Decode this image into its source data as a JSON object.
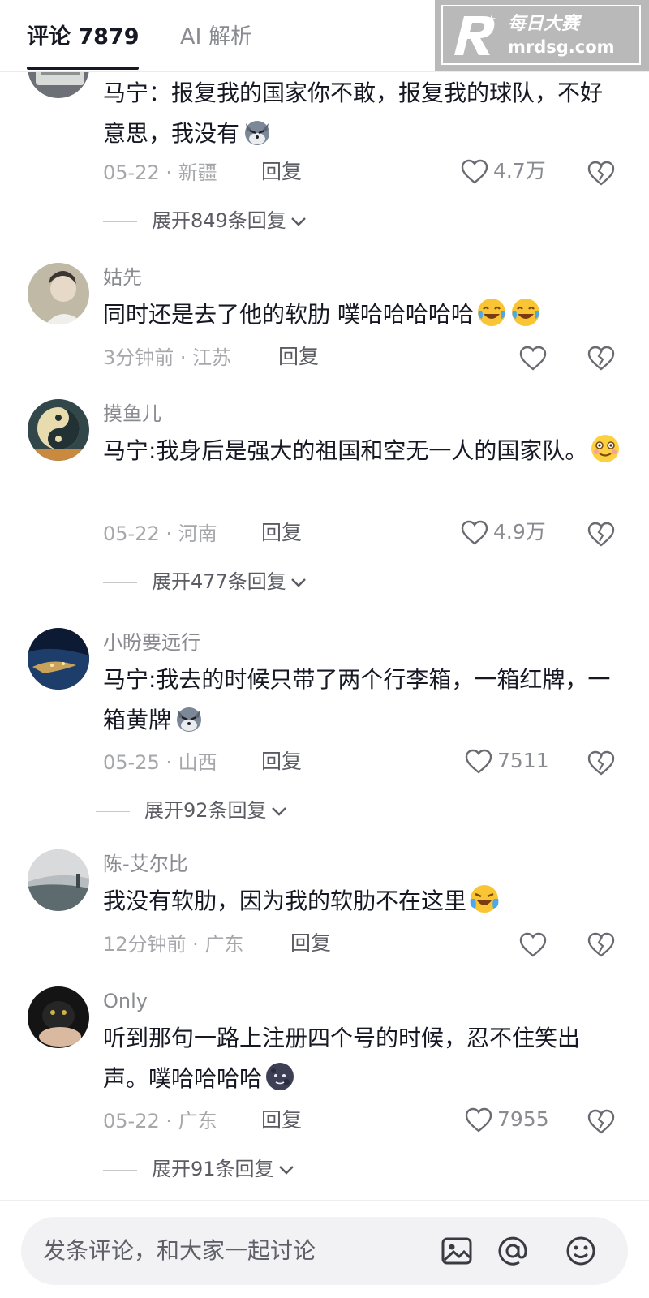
{
  "header": {
    "tab_comments": "评论 7879",
    "tab_ai": "AI 解析"
  },
  "watermark": {
    "cn": "每日大赛",
    "url": "mrdsg.com"
  },
  "comments": [
    {
      "username": "",
      "text": "马宁：报复我的国家你不敢，报复我的球队，不好意思，我没有",
      "emoji": "wolf-emoji",
      "date": "05-22",
      "location": "新疆",
      "reply_label": "回复",
      "likes": "4.7万",
      "expand": "展开849条回复"
    },
    {
      "username": "姑先",
      "text": "同时还是去了他的软肋 噗哈哈哈哈哈",
      "emoji": "laugh-cry-emoji",
      "date": "3分钟前",
      "location": "江苏",
      "reply_label": "回复",
      "likes": ""
    },
    {
      "username": "摸鱼儿",
      "text": "马宁:我身后是强大的祖国和空无一人的国家队。",
      "emoji": "smile-emoji",
      "date": "05-22",
      "location": "河南",
      "reply_label": "回复",
      "likes": "4.9万",
      "expand": "展开477条回复"
    },
    {
      "username": "小盼要远行",
      "text": "马宁:我去的时候只带了两个行李箱，一箱红牌，一箱黄牌",
      "emoji": "wolf-emoji",
      "date": "05-25",
      "location": "山西",
      "reply_label": "回复",
      "likes": "7511",
      "expand": "展开92条回复"
    },
    {
      "username": "陈-艾尔比",
      "text": "我没有软肋，因为我的软肋不在这里",
      "emoji": "cry-laugh-emoji",
      "date": "12分钟前",
      "location": "广东",
      "reply_label": "回复",
      "likes": ""
    },
    {
      "username": "Only",
      "text": "听到那句一路上注册四个号的时候，忍不住笑出声。噗哈哈哈哈",
      "emoji": "dark-moon-emoji",
      "date": "05-22",
      "location": "广东",
      "reply_label": "回复",
      "likes": "7955",
      "expand": "展开91条回复"
    }
  ],
  "input": {
    "placeholder": "发条评论，和大家一起讨论"
  },
  "colors": {
    "text_primary": "#161823",
    "text_secondary": "#8a8b91",
    "input_bg": "#f2f2f4"
  }
}
